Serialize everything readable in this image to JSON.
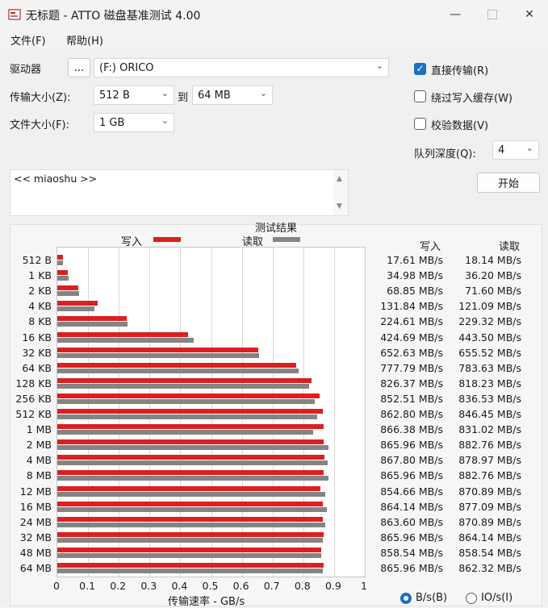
{
  "window": {
    "title": "无标题 - ATTO 磁盘基准测试 4.00"
  },
  "menu": {
    "file": "文件(F)",
    "help": "帮助(H)"
  },
  "controls": {
    "drive_label": "驱动器",
    "browse_label": "...",
    "drive_value": "(F:) ORICO",
    "transfer_label": "传输大小(Z):",
    "transfer_from": "512 B",
    "to_label": "到",
    "transfer_to": "64 MB",
    "filesize_label": "文件大小(F):",
    "filesize_value": "1 GB",
    "direct_io": {
      "label": "直接传输(R)",
      "checked": true
    },
    "bypass_cache": {
      "label": "绕过写入缓存(W)",
      "checked": false
    },
    "verify": {
      "label": "校验数据(V)",
      "checked": false
    },
    "queue_label": "队列深度(Q):",
    "queue_value": "4",
    "start_label": "开始",
    "description": "<< miaoshu >>"
  },
  "results": {
    "title": "测试结果",
    "legend_write": "写入",
    "legend_read": "读取",
    "col_write": "写入",
    "col_read": "读取",
    "xlabel": "传输速率 - GB/s",
    "unit_bs": {
      "label": "B/s(B)",
      "selected": true
    },
    "unit_ios": {
      "label": "IO/s(I)",
      "selected": false
    }
  },
  "colors": {
    "write": "#dc1f1f",
    "read": "#848484",
    "accent": "#1a6fc6"
  },
  "chart_data": {
    "type": "bar",
    "orientation": "horizontal",
    "categories": [
      "512 B",
      "1 KB",
      "2 KB",
      "4 KB",
      "8 KB",
      "16 KB",
      "32 KB",
      "64 KB",
      "128 KB",
      "256 KB",
      "512 KB",
      "1 MB",
      "2 MB",
      "4 MB",
      "8 MB",
      "12 MB",
      "16 MB",
      "24 MB",
      "32 MB",
      "48 MB",
      "64 MB"
    ],
    "series": [
      {
        "name": "写入",
        "values": [
          17.61,
          34.98,
          68.85,
          131.84,
          224.61,
          424.69,
          652.63,
          777.79,
          826.37,
          852.51,
          862.8,
          866.38,
          865.96,
          867.8,
          865.96,
          854.66,
          864.14,
          863.6,
          865.96,
          858.54,
          865.96
        ],
        "labels": [
          "17.61 MB/s",
          "34.98 MB/s",
          "68.85 MB/s",
          "131.84 MB/s",
          "224.61 MB/s",
          "424.69 MB/s",
          "652.63 MB/s",
          "777.79 MB/s",
          "826.37 MB/s",
          "852.51 MB/s",
          "862.80 MB/s",
          "866.38 MB/s",
          "865.96 MB/s",
          "867.80 MB/s",
          "865.96 MB/s",
          "854.66 MB/s",
          "864.14 MB/s",
          "863.60 MB/s",
          "865.96 MB/s",
          "858.54 MB/s",
          "865.96 MB/s"
        ]
      },
      {
        "name": "读取",
        "values": [
          18.14,
          36.2,
          71.6,
          121.09,
          229.32,
          443.5,
          655.52,
          783.63,
          818.23,
          836.53,
          846.45,
          831.02,
          882.76,
          878.97,
          882.76,
          870.89,
          877.09,
          870.89,
          864.14,
          858.54,
          862.32
        ],
        "labels": [
          "18.14 MB/s",
          "36.20 MB/s",
          "71.60 MB/s",
          "121.09 MB/s",
          "229.32 MB/s",
          "443.50 MB/s",
          "655.52 MB/s",
          "783.63 MB/s",
          "818.23 MB/s",
          "836.53 MB/s",
          "846.45 MB/s",
          "831.02 MB/s",
          "882.76 MB/s",
          "878.97 MB/s",
          "882.76 MB/s",
          "870.89 MB/s",
          "877.09 MB/s",
          "870.89 MB/s",
          "864.14 MB/s",
          "858.54 MB/s",
          "862.32 MB/s"
        ]
      }
    ],
    "xlim": [
      0,
      1
    ],
    "xticks": [
      "0",
      "0.1",
      "0.2",
      "0.3",
      "0.4",
      "0.5",
      "0.6",
      "0.7",
      "0.8",
      "0.9",
      "1"
    ],
    "xlabel": "传输速率 - GB/s",
    "grid": true
  }
}
